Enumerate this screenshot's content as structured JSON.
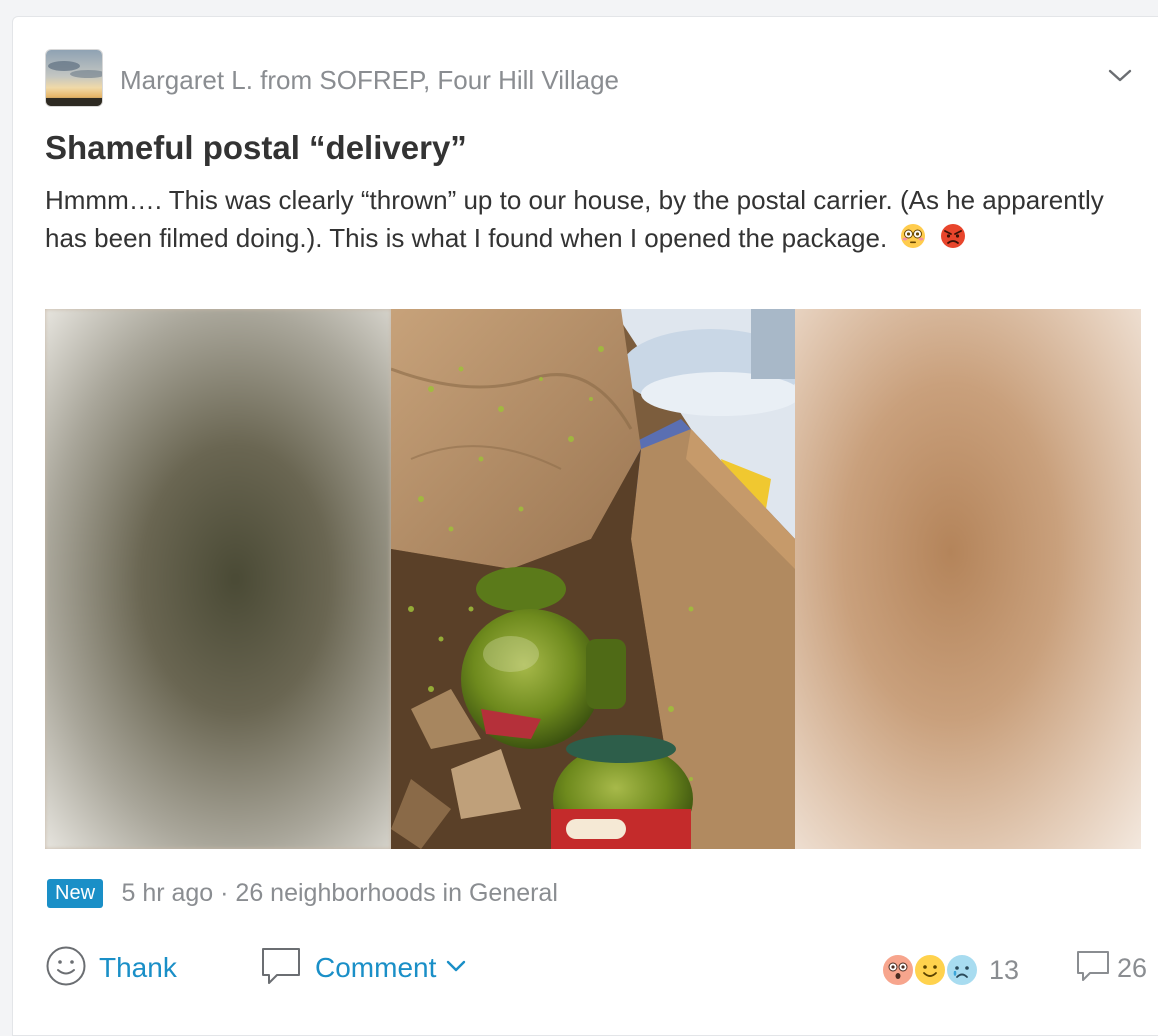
{
  "post": {
    "author": "Margaret L. from SOFREP, Four Hill Village",
    "title": "Shameful postal “delivery”",
    "body": "Hmmm…. This was clearly “thrown” up to our house, by the postal carrier. (As he apparently has been filmed doing.). This is what I found when I opened the package.",
    "body_emojis": [
      "flushed-face-icon",
      "angry-face-icon"
    ],
    "badge": "New",
    "meta": "5 hr ago · 26 neighborhoods in General"
  },
  "actions": {
    "thank_label": "Thank",
    "comment_label": "Comment"
  },
  "reactions": {
    "icons": [
      "shocked-face-icon",
      "smile-face-icon",
      "sad-face-icon"
    ],
    "count": "13"
  },
  "comments": {
    "count": "26"
  },
  "colors": {
    "accent": "#1a8fc7",
    "muted": "#8a8d91",
    "text": "#333333"
  }
}
